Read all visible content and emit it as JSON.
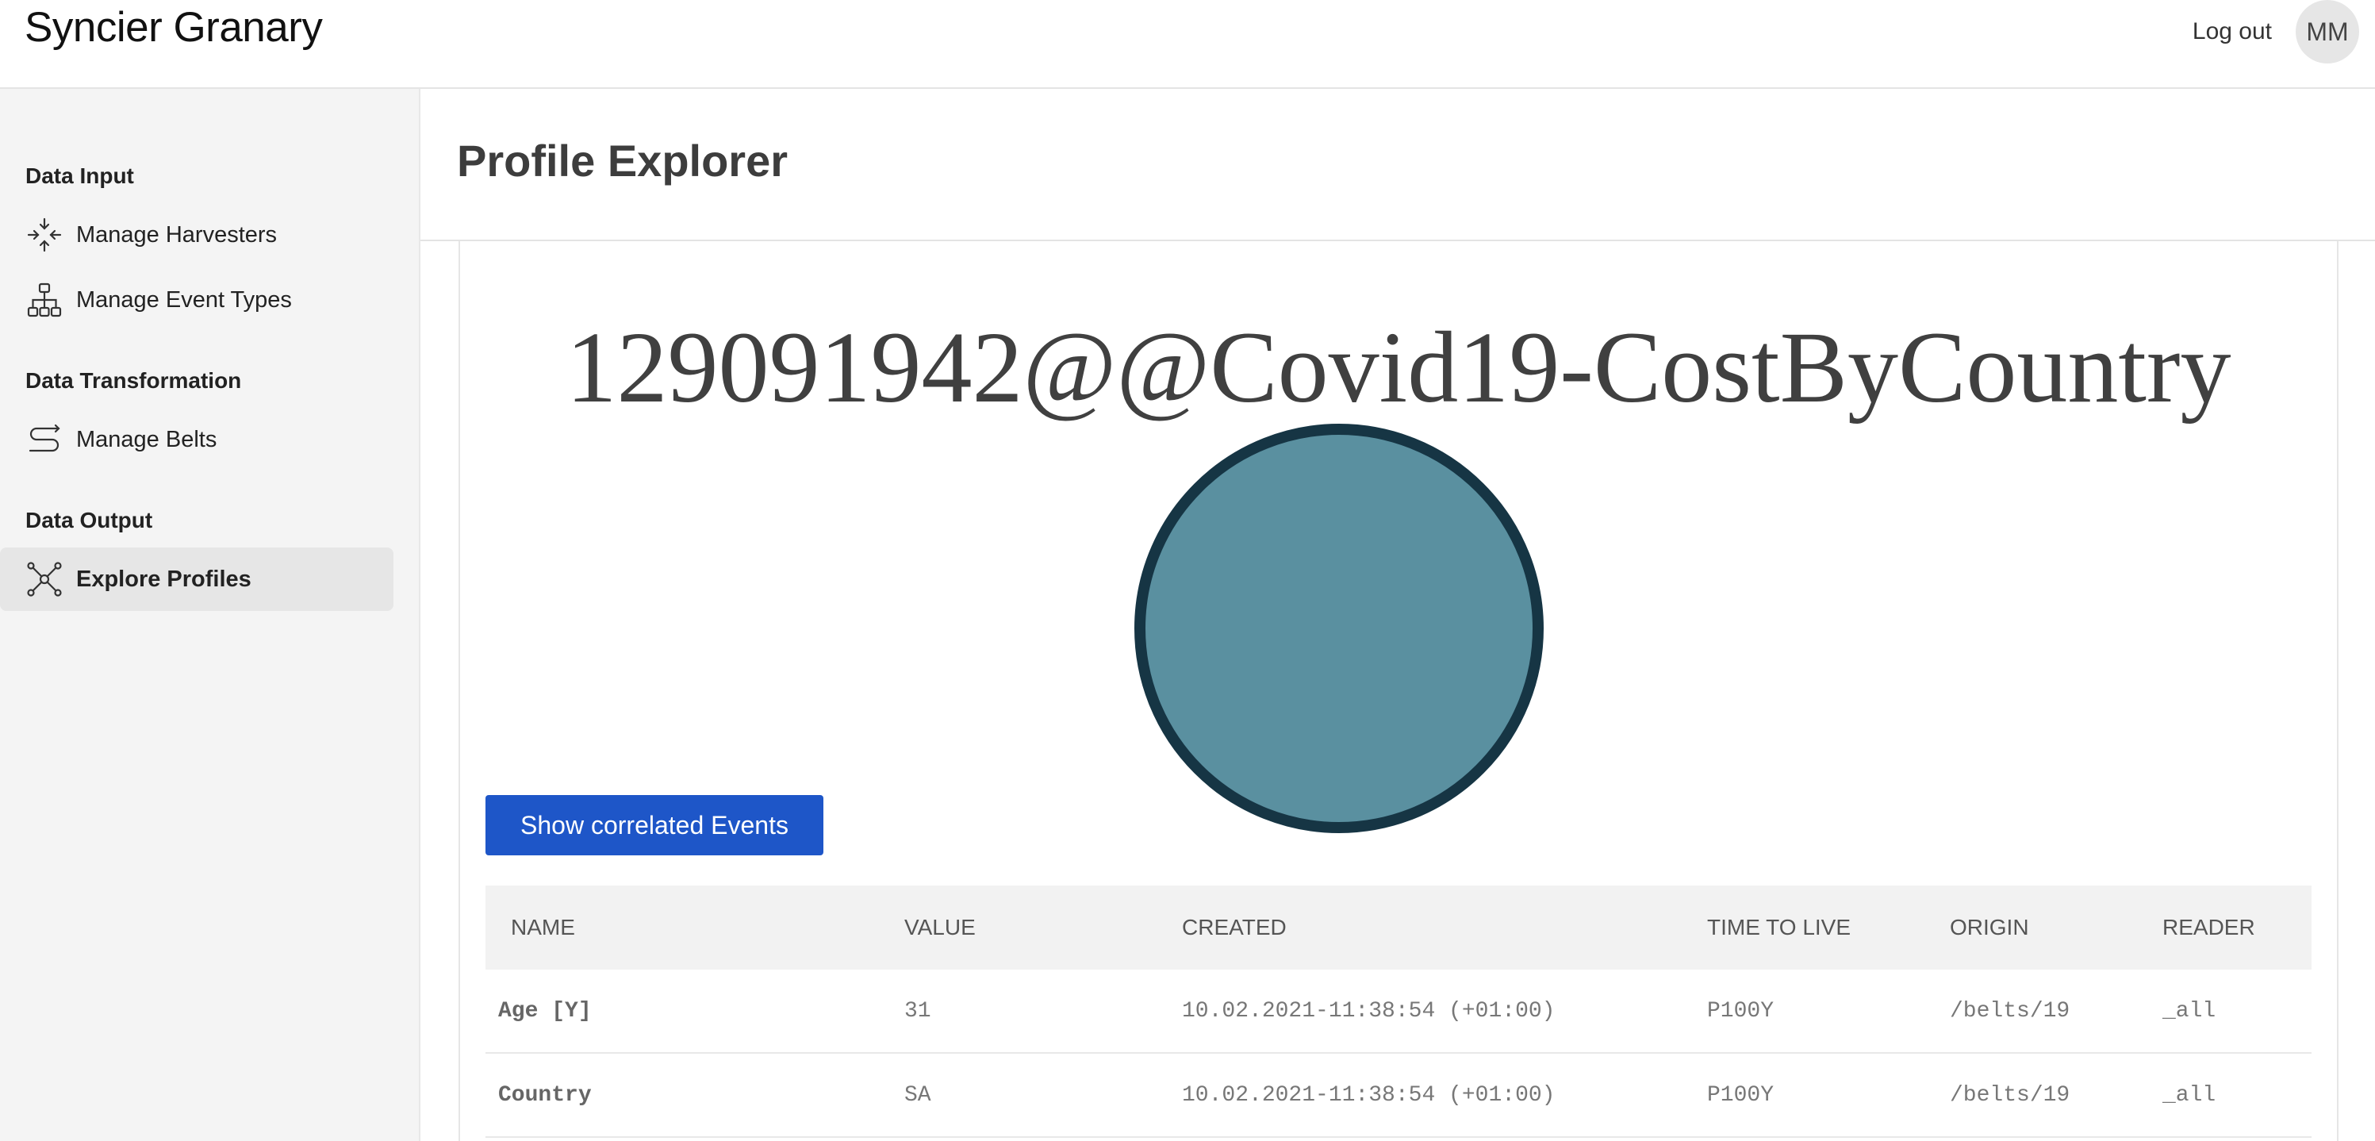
{
  "app": {
    "title": "Syncier Granary"
  },
  "header": {
    "logout_label": "Log out",
    "avatar_initials": "MM"
  },
  "sidebar": {
    "sections": [
      {
        "title": "Data Input",
        "items": [
          {
            "label": "Manage Harvesters",
            "icon": "harvester-icon"
          },
          {
            "label": "Manage Event Types",
            "icon": "hierarchy-icon"
          }
        ]
      },
      {
        "title": "Data Transformation",
        "items": [
          {
            "label": "Manage Belts",
            "icon": "belt-icon"
          }
        ]
      },
      {
        "title": "Data Output",
        "items": [
          {
            "label": "Explore Profiles",
            "icon": "network-icon",
            "active": true
          }
        ]
      }
    ]
  },
  "page": {
    "title": "Profile Explorer"
  },
  "profile": {
    "id": "129091942@@Covid19-CostByCountry",
    "node_fill": "#5a90a0",
    "node_stroke": "#163544"
  },
  "actions": {
    "show_correlated_label": "Show correlated Events"
  },
  "table": {
    "columns": [
      "NAME",
      "VALUE",
      "CREATED",
      "TIME TO LIVE",
      "ORIGIN",
      "READER"
    ],
    "rows": [
      {
        "name": "Age [Y]",
        "value": "31",
        "created": "10.02.2021-11:38:54 (+01:00)",
        "ttl": "P100Y",
        "origin": "/belts/19",
        "reader": "_all"
      },
      {
        "name": "Country",
        "value": "SA",
        "created": "10.02.2021-11:38:54 (+01:00)",
        "ttl": "P100Y",
        "origin": "/belts/19",
        "reader": "_all"
      }
    ]
  },
  "colors": {
    "primary_button": "#1e56c8",
    "sidebar_bg": "#f4f4f4",
    "active_item_bg": "#e6e6e6"
  }
}
